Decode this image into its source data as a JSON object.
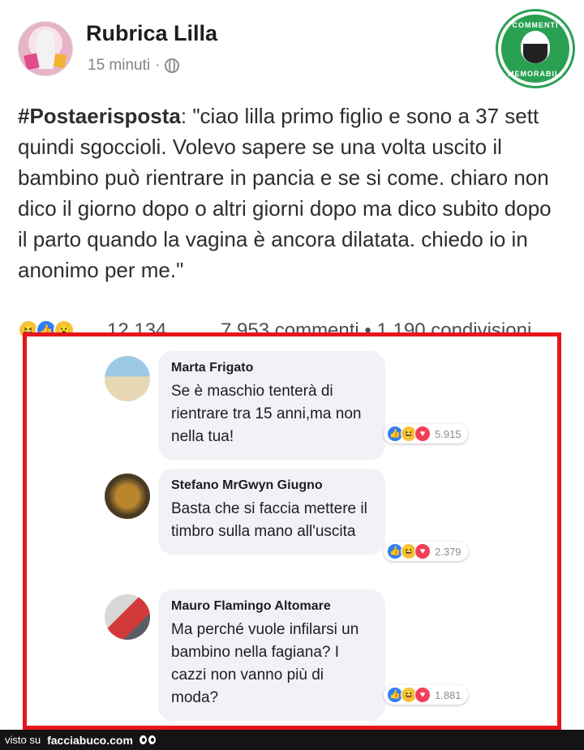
{
  "post": {
    "page_name": "Rubrica Lilla",
    "time": "15 minuti",
    "separator": "·",
    "hashtag": "#Postaerisposta",
    "body": ": \"ciao lilla primo figlio e sono a 37 sett quindi sgoccioli. Volevo sapere se una volta uscito il bambino può rientrare in pancia e se si come. chiaro non dico il giorno dopo o altri giorni dopo ma dico subito dopo il parto quando la vagina è ancora dilatata. chiedo io in anonimo per me.\"",
    "reaction_count": "12.134",
    "comments_shares": "7.953 commenti • 1.190 condivisioni",
    "reaction_icons": [
      "haha-icon",
      "like-icon",
      "wow-icon"
    ]
  },
  "badge": {
    "top_text": "COMMENTI",
    "bottom_text": "MEMORABILI"
  },
  "comments": [
    {
      "author": "Marta Frigato",
      "text": "Se è maschio tenterà di rientrare tra 15 anni,ma non nella tua!",
      "reactions": "5.915"
    },
    {
      "author": "Stefano MrGwyn Giugno",
      "text": "Basta che si faccia mettere il timbro sulla mano all'uscita",
      "reactions": "2.379"
    },
    {
      "author": "Mauro Flamingo Altomare",
      "text": "Ma perché vuole infilarsi un bambino nella fagiana? I cazzi non vanno più di moda?",
      "reactions": "1.881"
    }
  ],
  "footer": {
    "prefix": "visto su",
    "site": "facciabuco.com"
  },
  "colors": {
    "frame": "#e8151b",
    "badge": "#2aa052",
    "like": "#2d7ff9"
  }
}
